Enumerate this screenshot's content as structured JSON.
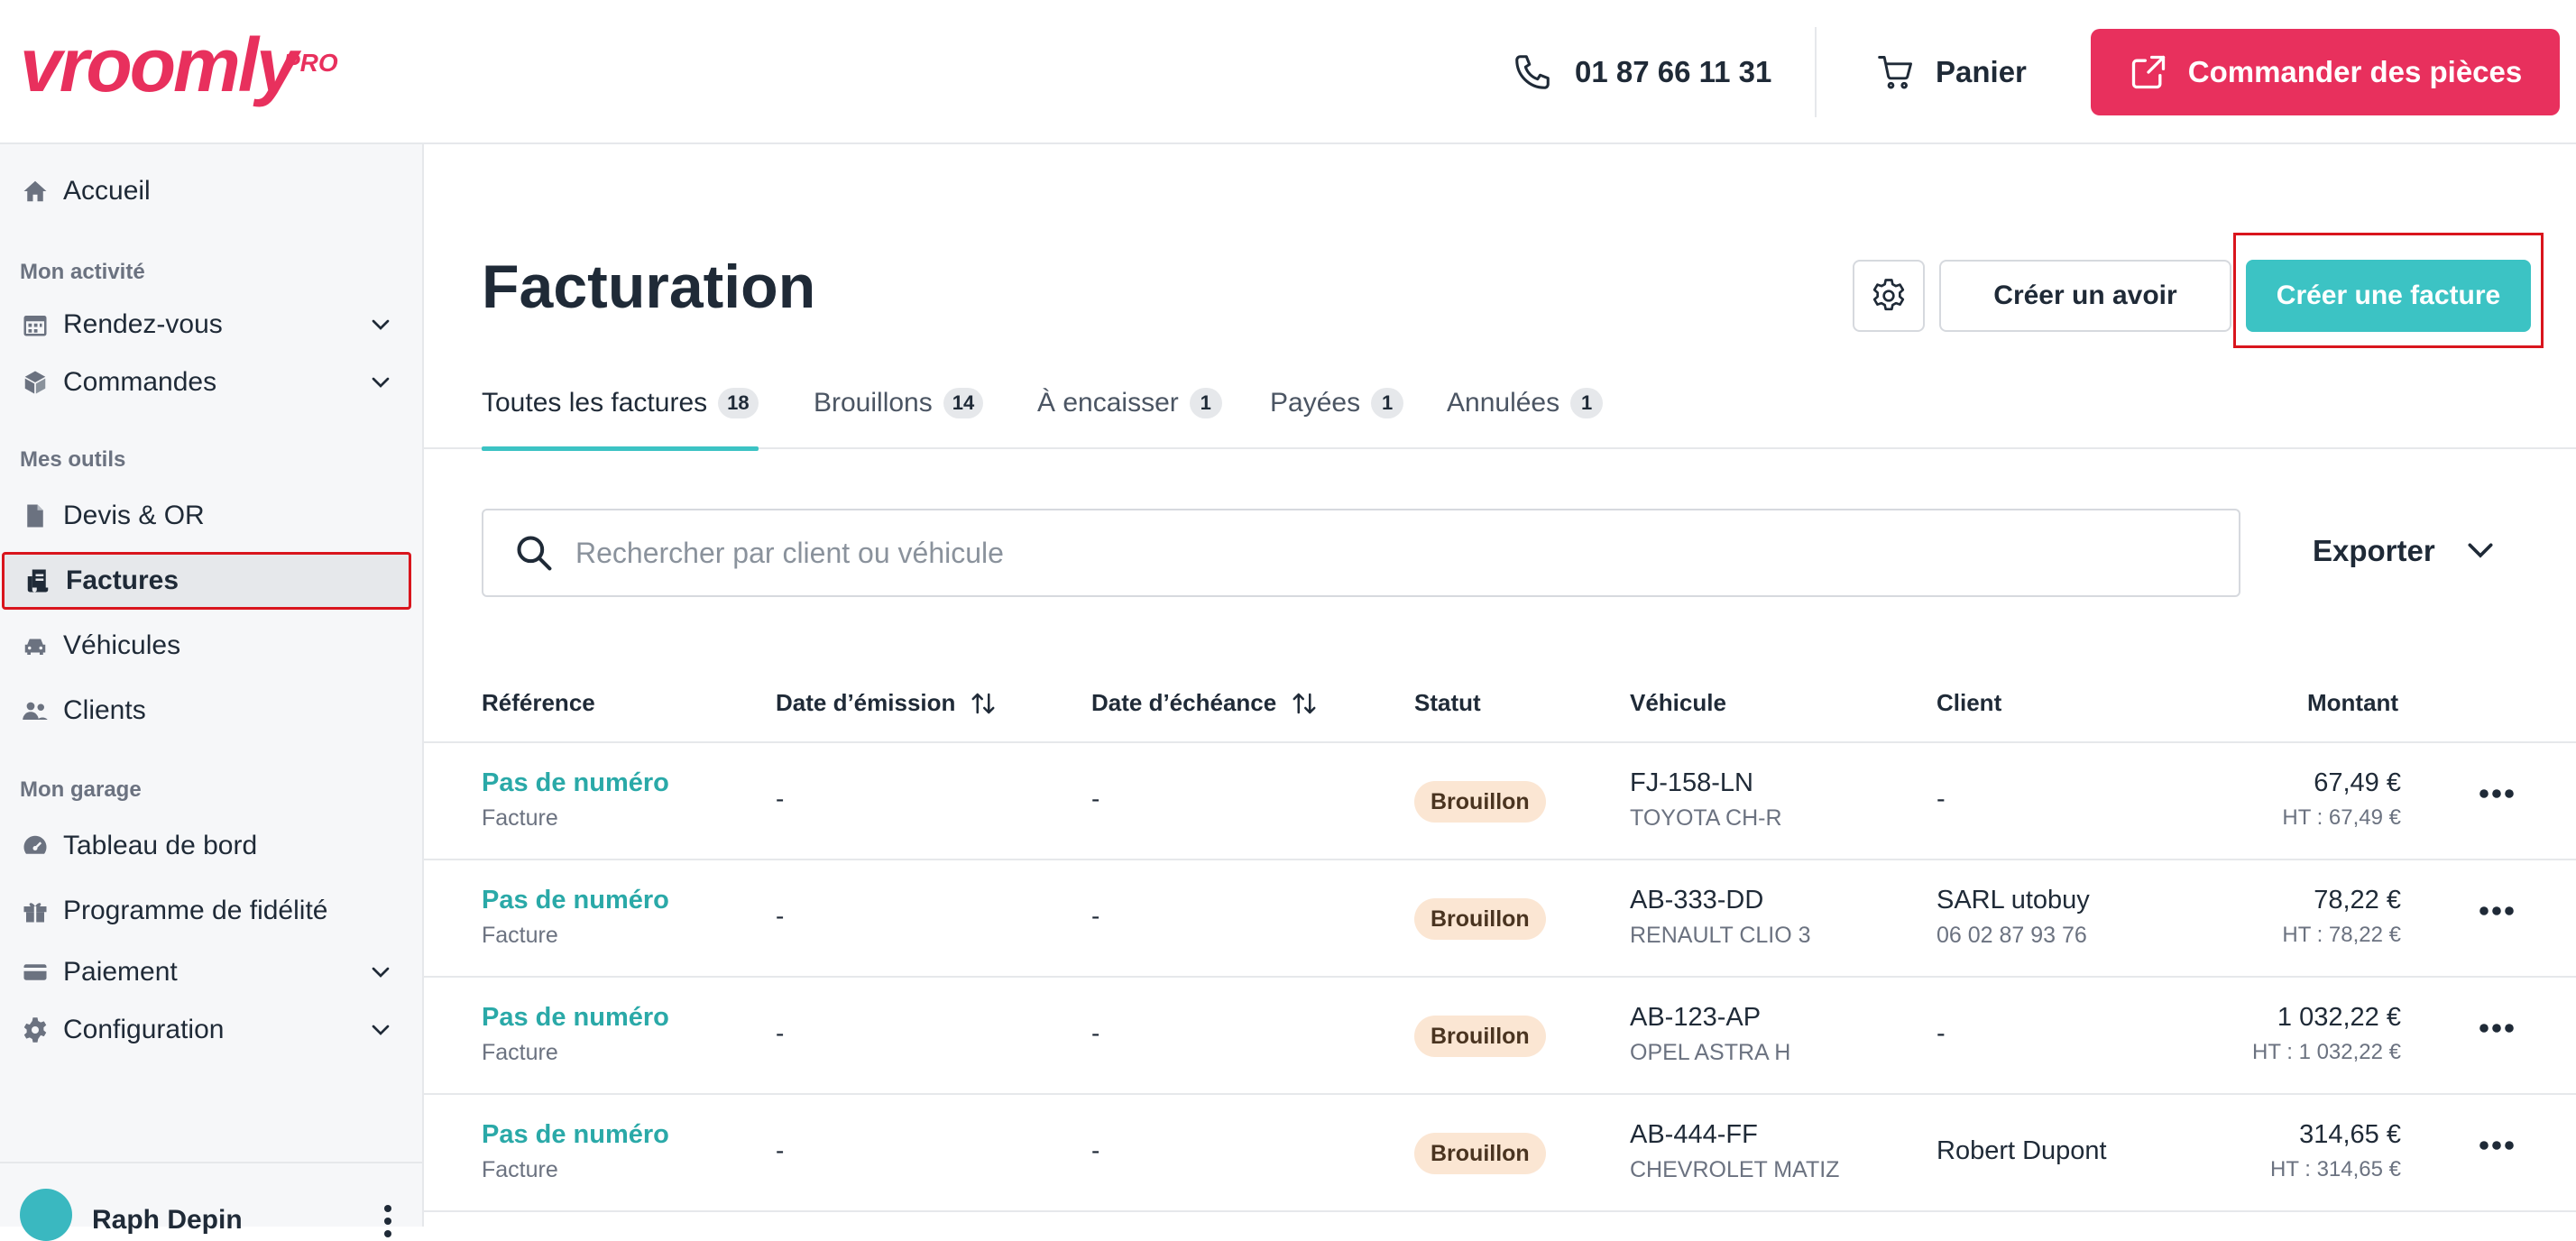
{
  "header": {
    "logo": "vroomly",
    "logo_suffix": "PRO",
    "phone": "01 87 66 11 31",
    "cart_label": "Panier",
    "order_label": "Commander des pièces",
    "brand_color": "#e8305d"
  },
  "sidebar": {
    "home": "Accueil",
    "sections": {
      "activity": "Mon activité",
      "tools": "Mes outils",
      "garage": "Mon garage"
    },
    "items": [
      {
        "label": "Rendez-vous",
        "icon": "calendar-icon"
      },
      {
        "label": "Commandes",
        "icon": "box-icon"
      },
      {
        "label": "Devis & OR",
        "icon": "document-icon"
      },
      {
        "label": "Factures",
        "icon": "invoice-icon",
        "active": true
      },
      {
        "label": "Véhicules",
        "icon": "car-icon"
      },
      {
        "label": "Clients",
        "icon": "users-icon"
      },
      {
        "label": "Tableau de bord",
        "icon": "dashboard-icon"
      },
      {
        "label": "Programme de fidélité",
        "icon": "gift-icon"
      },
      {
        "label": "Paiement",
        "icon": "card-icon"
      },
      {
        "label": "Configuration",
        "icon": "gear-icon"
      }
    ],
    "user_name": "Raph Depin"
  },
  "main": {
    "title": "Facturation",
    "create_credit_label": "Créer un avoir",
    "create_invoice_label": "Créer une facture",
    "accent_color": "#3cc3c4",
    "tabs": [
      {
        "label": "Toutes les factures",
        "count": "18",
        "active": true
      },
      {
        "label": "Brouillons",
        "count": "14"
      },
      {
        "label": "À encaisser",
        "count": "1"
      },
      {
        "label": "Payées",
        "count": "1"
      },
      {
        "label": "Annulées",
        "count": "1"
      }
    ],
    "search_placeholder": "Rechercher par client ou véhicule",
    "export_label": "Exporter",
    "columns": {
      "reference": "Référence",
      "issue_date": "Date d’émission",
      "due_date": "Date d’échéance",
      "status": "Statut",
      "vehicle": "Véhicule",
      "client": "Client",
      "amount": "Montant"
    },
    "rows": [
      {
        "ref": "Pas de numéro",
        "type": "Facture",
        "issue": "-",
        "due": "-",
        "status": "Brouillon",
        "plate": "FJ-158-LN",
        "model": "TOYOTA CH-R",
        "client": "-",
        "client_phone": "",
        "amount": "67,49 €",
        "ht": "HT : 67,49 €"
      },
      {
        "ref": "Pas de numéro",
        "type": "Facture",
        "issue": "-",
        "due": "-",
        "status": "Brouillon",
        "plate": "AB-333-DD",
        "model": "RENAULT CLIO 3",
        "client": "SARL utobuy",
        "client_phone": "06 02 87 93 76",
        "amount": "78,22 €",
        "ht": "HT : 78,22 €"
      },
      {
        "ref": "Pas de numéro",
        "type": "Facture",
        "issue": "-",
        "due": "-",
        "status": "Brouillon",
        "plate": "AB-123-AP",
        "model": "OPEL ASTRA H",
        "client": "-",
        "client_phone": "",
        "amount": "1 032,22 €",
        "ht": "HT : 1 032,22 €"
      },
      {
        "ref": "Pas de numéro",
        "type": "Facture",
        "issue": "-",
        "due": "-",
        "status": "Brouillon",
        "plate": "AB-444-FF",
        "model": "CHEVROLET MATIZ",
        "client": "Robert Dupont",
        "client_phone": "",
        "amount": "314,65 €",
        "ht": "HT : 314,65 €"
      }
    ]
  }
}
